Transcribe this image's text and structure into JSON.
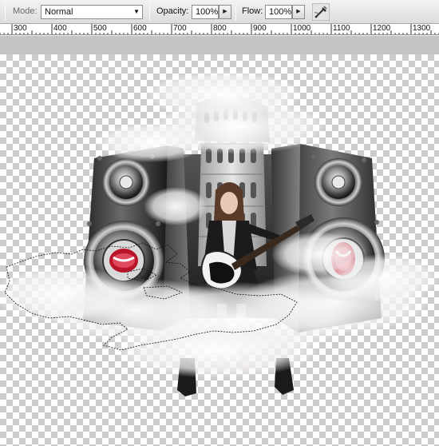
{
  "options": {
    "mode_label": "Mode:",
    "mode_value": "Normal",
    "opacity_label": "Opacity:",
    "opacity_value": "100%",
    "flow_label": "Flow:",
    "flow_value": "100%"
  },
  "icons": {
    "dropdown": "chevron-down-icon",
    "opacity_spin": "triangle-right-icon",
    "flow_spin": "triangle-right-icon",
    "airbrush": "airbrush-icon"
  },
  "ruler": {
    "labels": [
      "300",
      "400",
      "500",
      "600",
      "700",
      "800",
      "900",
      "1000",
      "1100",
      "1200",
      "1300"
    ]
  },
  "colors": {
    "pasteboard": "#c4c4c4",
    "checker_dark": "#cccccc",
    "checker_light": "#ffffff",
    "lips_red": "#d8283a"
  }
}
